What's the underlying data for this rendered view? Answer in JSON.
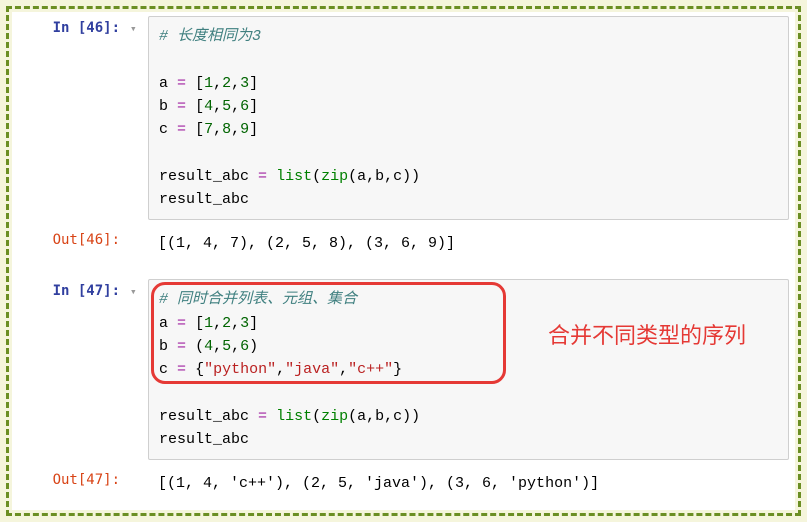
{
  "cells": [
    {
      "in_prompt": "In [46]:",
      "toggle": "▾",
      "code": {
        "comment": "# 长度相同为3",
        "line_a": {
          "var": "a",
          "op": "=",
          "b1": "[",
          "n1": "1",
          "c1": ",",
          "n2": "2",
          "c2": ",",
          "n3": "3",
          "b2": "]"
        },
        "line_b": {
          "var": "b",
          "op": "=",
          "b1": "[",
          "n1": "4",
          "c1": ",",
          "n2": "5",
          "c2": ",",
          "n3": "6",
          "b2": "]"
        },
        "line_c": {
          "var": "c",
          "op": "=",
          "b1": "[",
          "n1": "7",
          "c1": ",",
          "n2": "8",
          "c2": ",",
          "n3": "9",
          "b2": "]"
        },
        "result_line": {
          "var": "result_abc",
          "op": "=",
          "fn1": "list",
          "p1": "(",
          "fn2": "zip",
          "p2": "(",
          "args": "a,b,c",
          "p3": ")",
          "p4": ")"
        },
        "result_var": "result_abc"
      },
      "out_prompt": "Out[46]:",
      "output": "[(1, 4, 7), (2, 5, 8), (3, 6, 9)]"
    },
    {
      "in_prompt": "In [47]:",
      "toggle": "▾",
      "code": {
        "comment": "# 同时合并列表、元组、集合",
        "line_a": {
          "var": "a",
          "op": "=",
          "b1": "[",
          "n1": "1",
          "c1": ",",
          "n2": "2",
          "c2": ",",
          "n3": "3",
          "b2": "]"
        },
        "line_b": {
          "var": "b",
          "op": "=",
          "b1": "(",
          "n1": "4",
          "c1": ",",
          "n2": "5",
          "c2": ",",
          "n3": "6",
          "b2": ")"
        },
        "line_c": {
          "var": "c",
          "op": "=",
          "b1": "{",
          "s1": "\"python\"",
          "c1": ",",
          "s2": "\"java\"",
          "c2": ",",
          "s3": "\"c++\"",
          "b2": "}"
        },
        "result_line": {
          "var": "result_abc",
          "op": "=",
          "fn1": "list",
          "p1": "(",
          "fn2": "zip",
          "p2": "(",
          "args": "a,b,c",
          "p3": ")",
          "p4": ")"
        },
        "result_var": "result_abc"
      },
      "out_prompt": "Out[47]:",
      "output": "[(1, 4, 'c++'), (2, 5, 'java'), (3, 6, 'python')]"
    }
  ],
  "annotation_text": "合并不同类型的序列"
}
